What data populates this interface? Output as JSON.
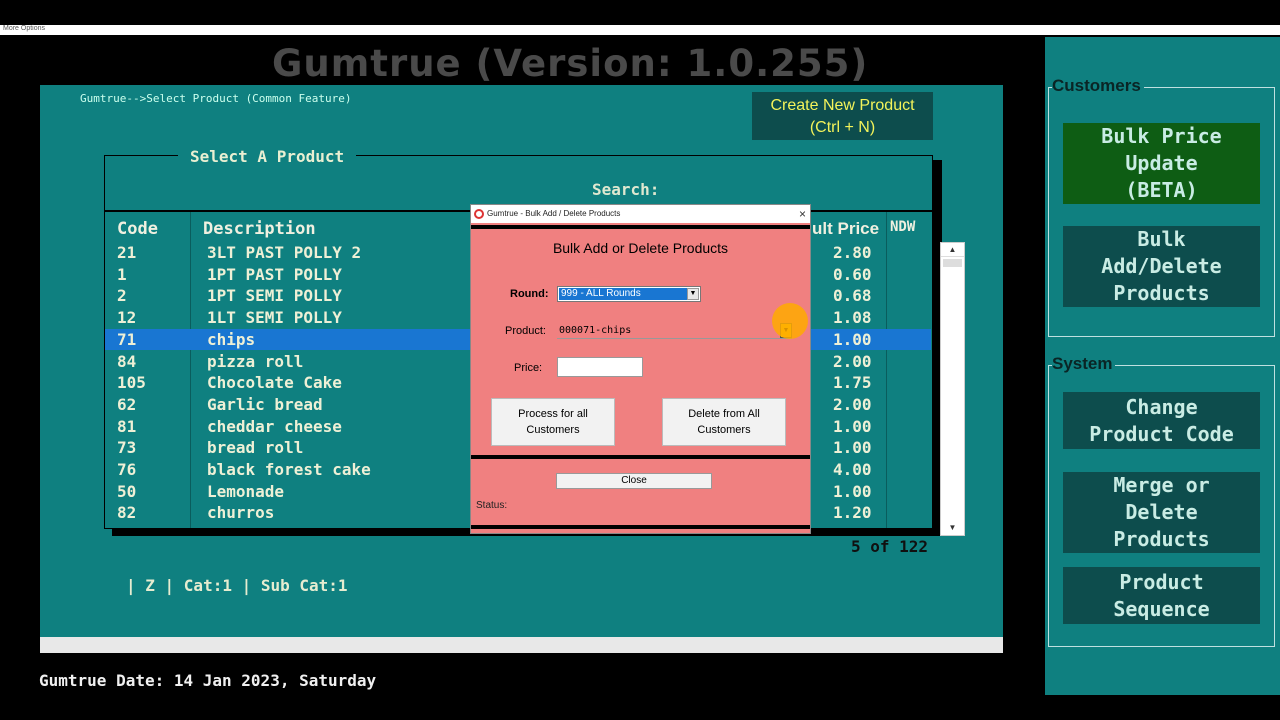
{
  "top_bar": {
    "label": "More Options"
  },
  "app_title": "Gumtrue (Version: 1.0.255)",
  "breadcrumb": "Gumtrue-->Select Product (Common Feature)",
  "create_button": {
    "line1": "Create New Product",
    "line2": "(Ctrl + N)"
  },
  "product_list": {
    "legend": "Select A Product",
    "search_label": "Search:",
    "columns": {
      "code": "Code",
      "description": "Description",
      "price": "ult Price",
      "ndw": "NDW"
    },
    "rows": [
      {
        "code": "21",
        "description": "3LT PAST POLLY 2",
        "price": "2.80"
      },
      {
        "code": "1",
        "description": "1PT PAST POLLY",
        "price": "0.60"
      },
      {
        "code": "2",
        "description": "1PT SEMI POLLY",
        "price": "0.68"
      },
      {
        "code": "12",
        "description": "1LT SEMI POLLY",
        "price": "1.08"
      },
      {
        "code": "71",
        "description": "chips",
        "price": "1.00"
      },
      {
        "code": "84",
        "description": "pizza roll",
        "price": "2.00"
      },
      {
        "code": "105",
        "description": "Chocolate Cake",
        "price": "1.75"
      },
      {
        "code": "62",
        "description": "Garlic bread",
        "price": "2.00"
      },
      {
        "code": "81",
        "description": "cheddar cheese",
        "price": "1.00"
      },
      {
        "code": "73",
        "description": "bread roll",
        "price": "1.00"
      },
      {
        "code": "76",
        "description": "black forest cake",
        "price": "4.00"
      },
      {
        "code": "50",
        "description": "Lemonade",
        "price": "1.00"
      },
      {
        "code": "82",
        "description": "churros",
        "price": "1.20"
      }
    ],
    "selected_index": 4,
    "counter": "5 of 122"
  },
  "cat_line": "| Z | Cat:1 | Sub Cat:1",
  "date_line": "Gumtrue Date: 14 Jan 2023, Saturday",
  "sidebar": {
    "customers_label": "Customers",
    "system_label": "System",
    "bulk_price": "Bulk Price\nUpdate\n(BETA)",
    "bulk_add_delete": "Bulk\nAdd/Delete\nProducts",
    "change_code": "Change\nProduct Code",
    "merge_delete": "Merge or\nDelete\nProducts",
    "product_sequence": "Product\nSequence"
  },
  "dialog": {
    "title": "Gumtrue - Bulk Add / Delete Products",
    "close_x": "×",
    "heading": "Bulk Add or Delete Products",
    "round_label": "Round:",
    "round_value": "999 - ALL Rounds",
    "product_label": "Product:",
    "product_value": "000071-chips",
    "price_label": "Price:",
    "price_value": "",
    "process_button": "Process for all\nCustomers",
    "delete_button": "Delete from All\nCustomers",
    "close_button": "Close",
    "status_label": "Status:"
  },
  "colors": {
    "teal": "#0f8080",
    "dark_teal": "#0d4d4d",
    "selection": "#1976d2",
    "dialog_bg": "#f08080",
    "accent_yellow": "#f3f35a"
  }
}
